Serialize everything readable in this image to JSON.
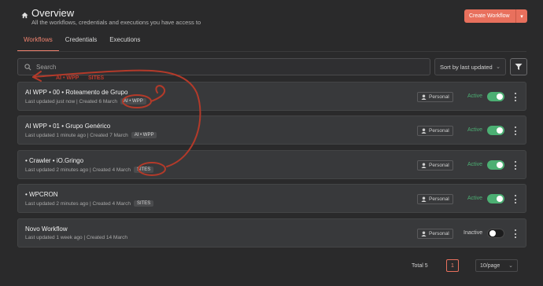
{
  "header": {
    "title": "Overview",
    "subtitle": "All the workflows, credentials and executions you have access to",
    "create_label": "Create Workflow"
  },
  "tabs": [
    {
      "label": "Workflows",
      "active": true
    },
    {
      "label": "Credentials",
      "active": false
    },
    {
      "label": "Executions",
      "active": false
    }
  ],
  "search": {
    "placeholder": "Search"
  },
  "sort": {
    "label": "Sort by last updated"
  },
  "annotations": {
    "label_1": "AI • WPP",
    "label_2": "SITES",
    "color": "#c0392b"
  },
  "workflows": [
    {
      "name": "AI WPP • 00 • Roteamento de Grupo",
      "meta": "Last updated just now | Created 6 March",
      "tag": "AI • WPP",
      "owner": "Personal",
      "status": "Active",
      "active": true
    },
    {
      "name": "AI WPP • 01 • Grupo Genérico",
      "meta": "Last updated 1 minute ago | Created 7 March",
      "tag": "AI • WPP",
      "owner": "Personal",
      "status": "Active",
      "active": true
    },
    {
      "name": "• Crawler • iO.Gringo",
      "meta": "Last updated 2 minutes ago | Created 4 March",
      "tag": "SITES",
      "owner": "Personal",
      "status": "Active",
      "active": true
    },
    {
      "name": "• WPCRON",
      "meta": "Last updated 2 minutes ago | Created 4 March",
      "tag": "SITES",
      "owner": "Personal",
      "status": "Active",
      "active": true
    },
    {
      "name": "Novo Workflow",
      "meta": "Last updated 1 week ago | Created 14 March",
      "tag": "",
      "owner": "Personal",
      "status": "Inactive",
      "active": false
    }
  ],
  "pagination": {
    "total": "Total 5",
    "page": "1",
    "per_page": "10/page"
  },
  "colors": {
    "accent": "#e8705d",
    "active_toggle": "#4caf73",
    "background": "#2a2a2b",
    "card": "#38393b"
  }
}
